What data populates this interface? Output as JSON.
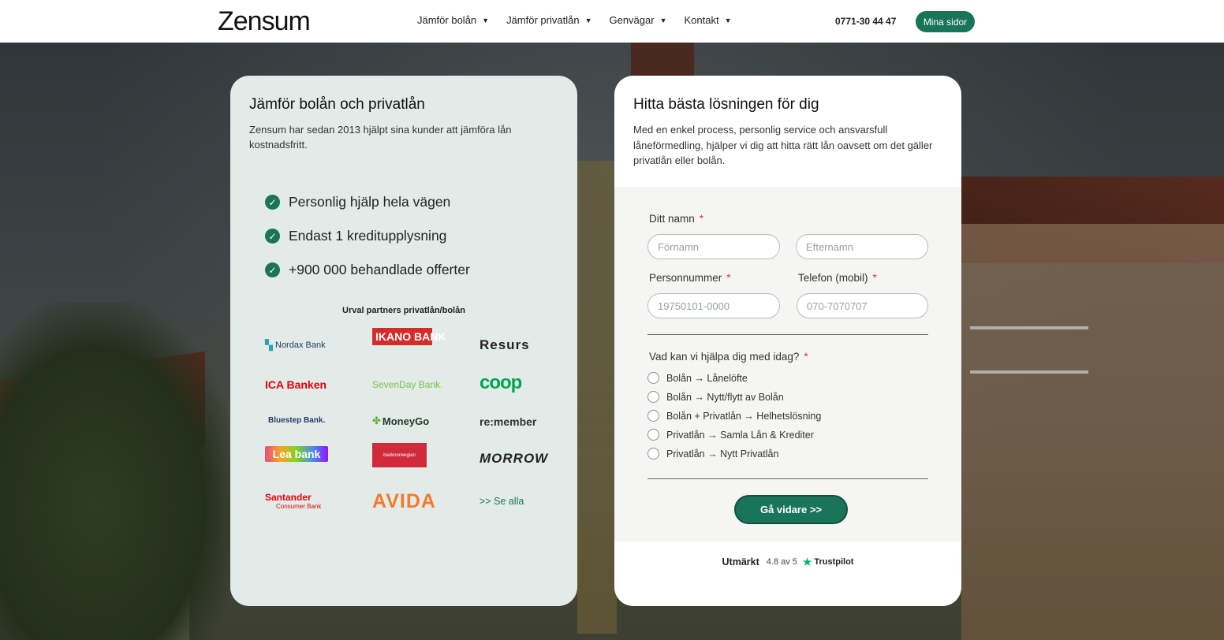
{
  "header": {
    "logo": "Zensum",
    "nav": [
      {
        "label": "Jämför bolån"
      },
      {
        "label": "Jämför privatlån"
      },
      {
        "label": "Genvägar"
      },
      {
        "label": "Kontakt"
      }
    ],
    "phone": "0771-30 44 47",
    "account_button": "Mina sidor"
  },
  "left_card": {
    "title": "Jämför bolån och privatlån",
    "description": "Zensum har sedan 2013 hjälpt sina kunder att jämföra lån kostnadsfritt.",
    "usps": [
      "Personlig hjälp hela vägen",
      "Endast 1 kreditupplysning",
      "+900 000 behandlade offerter"
    ],
    "partners_title": "Urval partners privatlån/bolån",
    "partners": [
      {
        "name": "Nordax Bank",
        "color": "#1d3c5a"
      },
      {
        "name": "IKANO BANK",
        "color": "#d42b2b"
      },
      {
        "name": "Resurs",
        "color": "#222222"
      },
      {
        "name": "ICA Banken",
        "color": "#e3000b"
      },
      {
        "name": "SevenDay Bank.",
        "color": "#7bbf4a"
      },
      {
        "name": "coop",
        "color": "#00a651"
      },
      {
        "name": "Bluestep Bank.",
        "color": "#1f3a5f"
      },
      {
        "name": "MoneyGo",
        "color": "#6aae2e"
      },
      {
        "name": "re:member",
        "color": "#333333"
      },
      {
        "name": "Lea bank",
        "color": "#ffffff"
      },
      {
        "name": "banknorwegian",
        "color": "#d12a3a"
      },
      {
        "name": "MORROW",
        "color": "#222222"
      },
      {
        "name": "Santander",
        "sub": "Consumer Bank",
        "color": "#ec0000"
      },
      {
        "name": "AVIDA",
        "color": "#f27a2a"
      }
    ],
    "see_all": ">> Se alla"
  },
  "right_card": {
    "title": "Hitta bästa lösningen för dig",
    "description": "Med en enkel process, personlig service och ansvarsfull låneförmedling, hjälper vi dig att hitta rätt lån oavsett om det gäller privatlån eller bolån.",
    "form": {
      "name_label": "Ditt namn",
      "required_mark": "*",
      "firstname_placeholder": "Förnamn",
      "lastname_placeholder": "Efternamn",
      "ssn_label": "Personnummer",
      "ssn_placeholder": "19750101-0000",
      "phone_label": "Telefon (mobil)",
      "phone_placeholder": "070-7070707",
      "help_label": "Vad kan vi hjälpa dig med idag?",
      "options": [
        "Bolån → Lånelöfte",
        "Bolån → Nytt/flytt av Bolån",
        "Bolån + Privatlån → Helhetslösning",
        "Privatlån → Samla Lån & Krediter",
        "Privatlån → Nytt Privatlån"
      ],
      "submit": "Gå vidare >>"
    },
    "trustpilot": {
      "rating_label": "Utmärkt",
      "score": "4.8 av 5",
      "brand": "Trustpilot"
    }
  },
  "colors": {
    "accent": "#1a7458",
    "left_card_bg": "#e3ebe8",
    "required": "#d13a3a"
  }
}
